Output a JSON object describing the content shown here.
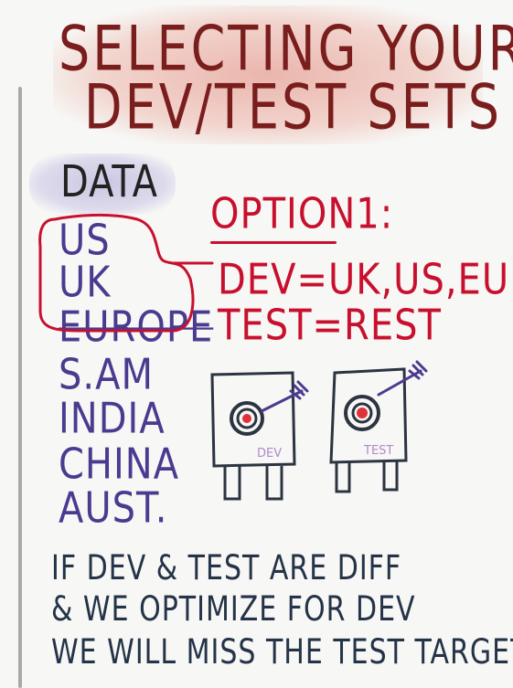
{
  "title": {
    "line1": "SELECTING YOUR",
    "line2": "DEV/TEST SETS"
  },
  "data_label": "DATA",
  "regions": [
    "US",
    "UK",
    "EUROPE",
    "S.AM",
    "INDIA",
    "CHINA",
    "AUST."
  ],
  "option": {
    "title": "OPTION1:",
    "dev": "DEV=UK,US,EUR",
    "test": "TEST=REST"
  },
  "targets": {
    "dev_label": "DEV",
    "test_label": "TEST"
  },
  "footer": {
    "line1": "IF DEV & TEST ARE DIFF",
    "line2": "& WE OPTIMIZE FOR DEV",
    "line3": "WE WILL MISS THE TEST TARGET"
  },
  "colors": {
    "title": "#7a1d1d",
    "highlight_title": "#e8aaa0",
    "highlight_data": "#c8c4e1",
    "regions": "#4b3a8f",
    "option": "#c8102e",
    "target_outline": "#2b3440",
    "bullseye": "#e0313a",
    "arrow": "#4b3a8f",
    "footer": "#243348"
  }
}
